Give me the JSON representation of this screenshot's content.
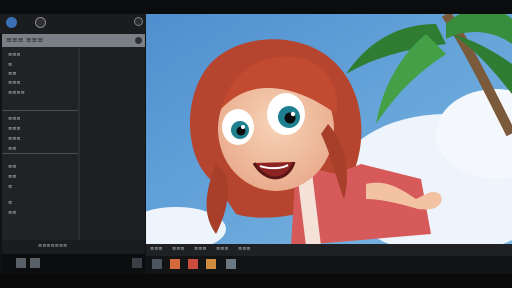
{
  "left_panel": {
    "selector_label": "☰ ≡≡≡",
    "panel_title": "≡≡≡ ≡≡≡",
    "rows": [
      "≡≡≡",
      "≡",
      "≡≡",
      "≡≡≡",
      "≡≡≡≡",
      "≡≡≡",
      "≡≡≡",
      "≡≡≡",
      "≡≡",
      "≡≡",
      "≡≡",
      "≡",
      "≡",
      "≡≡"
    ],
    "footer_label": "≡≡≡≡≡≡≡"
  },
  "status_bar": {
    "items": [
      "≡≡≡",
      "≡≡≡",
      "≡≡≡",
      "≡≡≡",
      "≡≡≡"
    ]
  },
  "colors": {
    "sky": "#5da0d6",
    "hair": "#b5452e",
    "dress": "#d65a5a",
    "skin": "#f2c2a2",
    "panel_header": "#7b8086"
  },
  "icons": [
    "app-icon",
    "menu-icon",
    "back-icon",
    "close-icon",
    "brush-icon",
    "pencil-icon",
    "paint-bucket-icon",
    "eraser-icon",
    "layer-icon"
  ]
}
